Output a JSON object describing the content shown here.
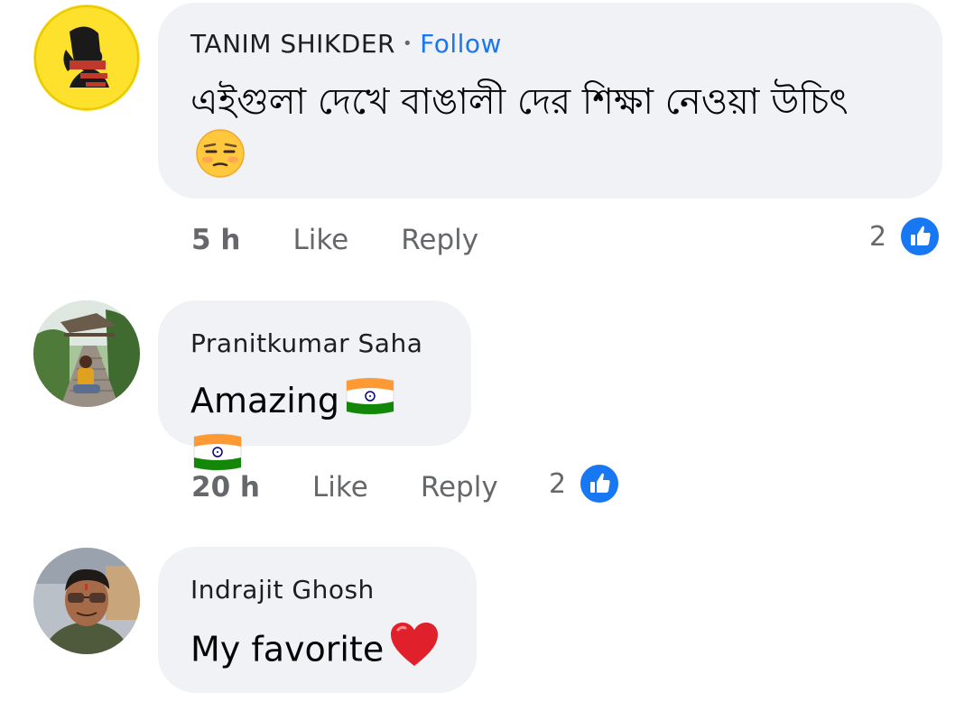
{
  "comments": [
    {
      "author": "TANIM SHIKDER",
      "separator": "•",
      "follow": "Follow",
      "text": "এইগুলা দেখে বাঙালী  দের শিক্ষা নেওয়া উচিৎ",
      "time": "5 h",
      "like": "Like",
      "reply": "Reply",
      "reaction_count": "2"
    },
    {
      "author": "Pranitkumar Saha",
      "text": "Amazing",
      "time": "20 h",
      "like": "Like",
      "reply": "Reply",
      "reaction_count": "2"
    },
    {
      "author": "Indrajit Ghosh",
      "text": "My favorite"
    }
  ],
  "colors": {
    "bubble": "#f0f2f5",
    "link": "#1877f2",
    "meta": "#65676b",
    "like_badge": "#1877f2"
  },
  "icons": [
    "unamused-face-emoji",
    "india-flag-emoji",
    "red-heart-emoji",
    "thumbs-up-icon"
  ]
}
